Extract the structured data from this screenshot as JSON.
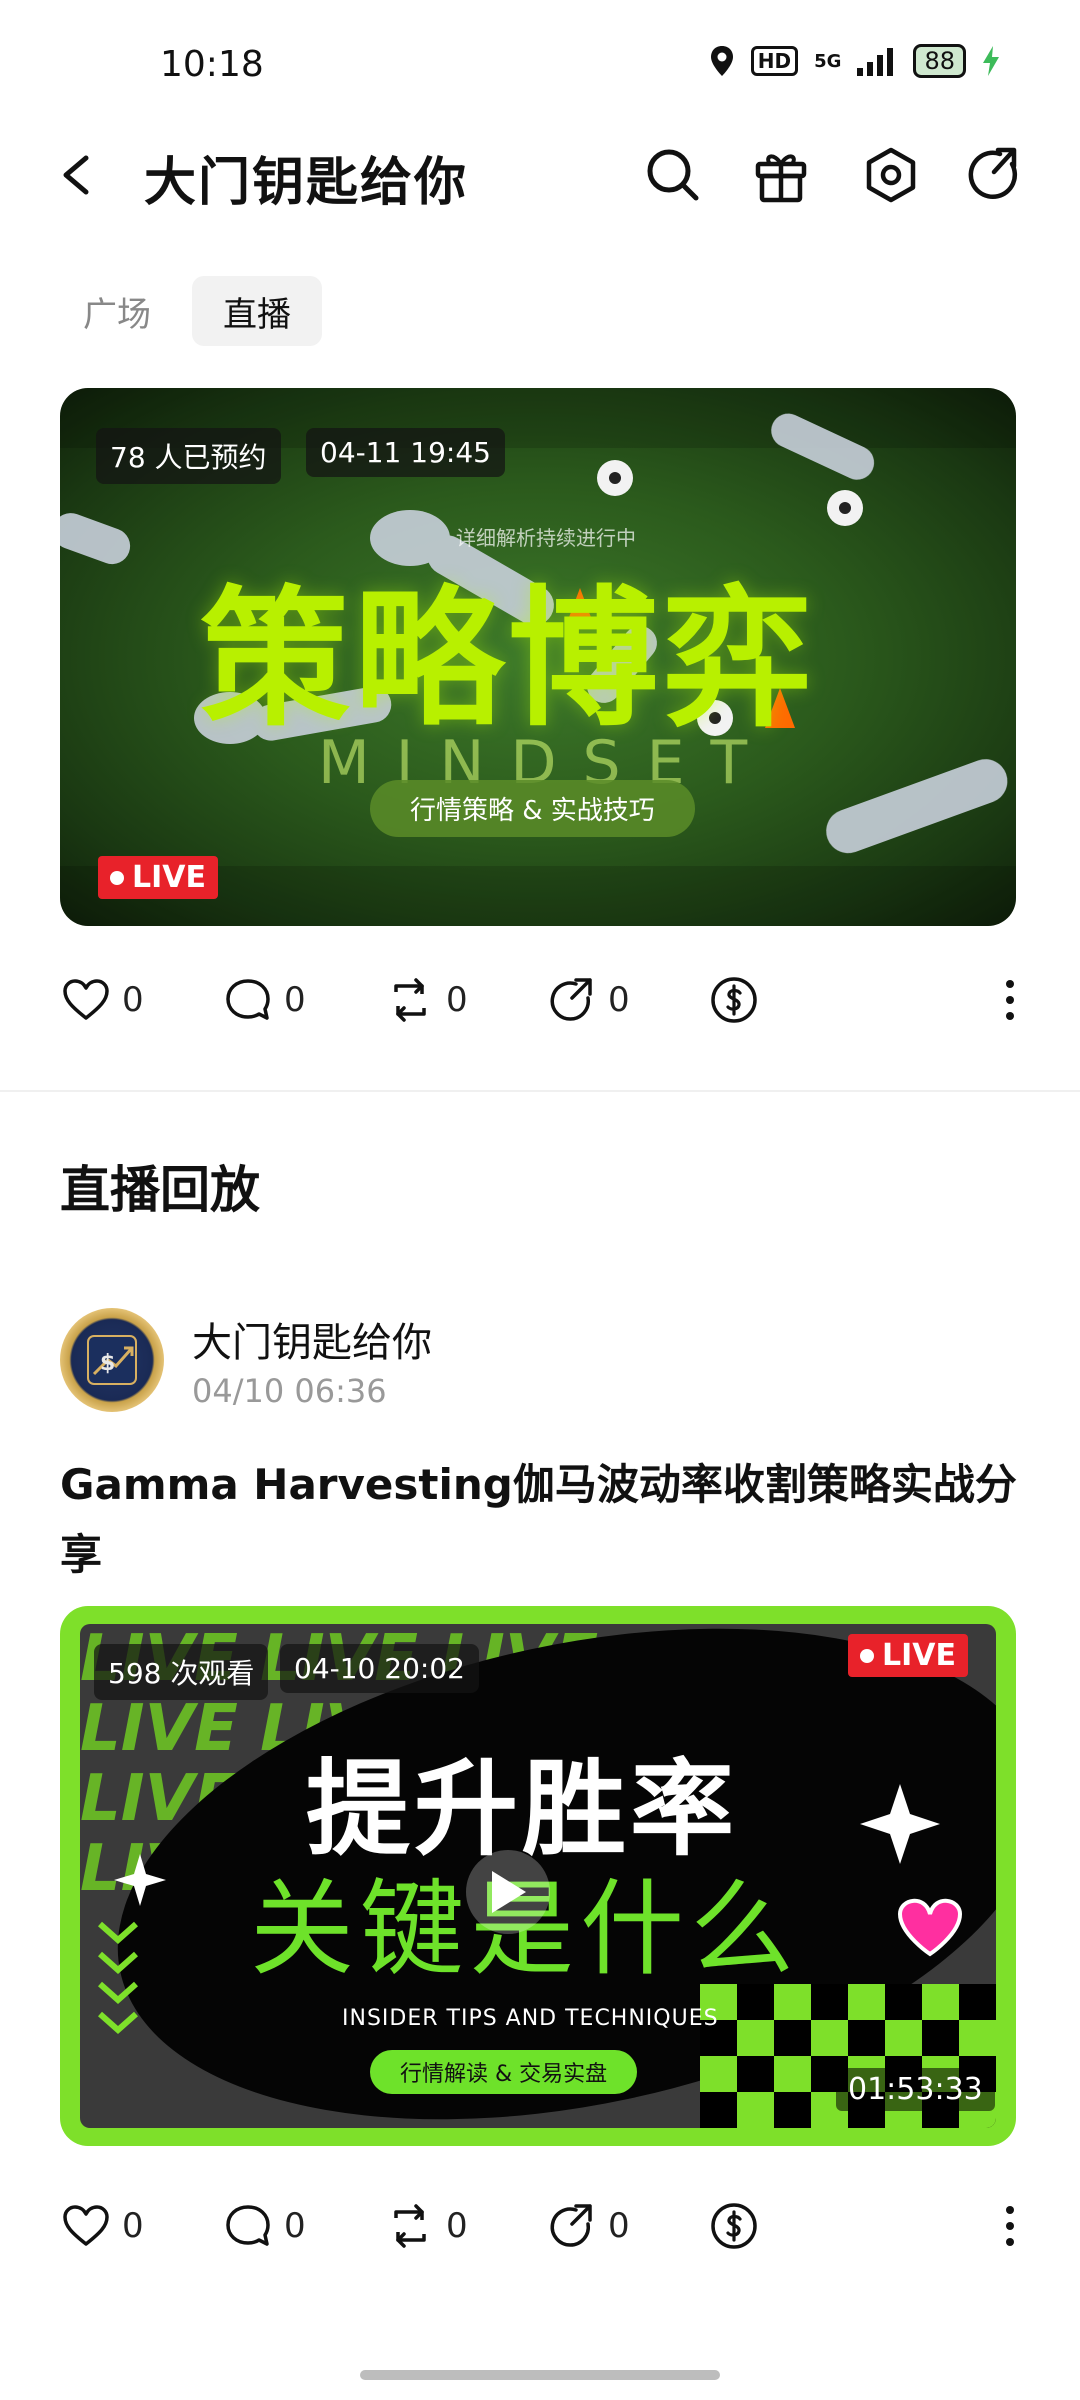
{
  "status_bar": {
    "time": "10:18",
    "hd": "HD",
    "network": "5G",
    "battery": "88"
  },
  "header": {
    "title": "大门钥匙给你",
    "icons": [
      "back-icon",
      "search-icon",
      "gift-icon",
      "settings-icon",
      "share-icon"
    ]
  },
  "tabs": [
    {
      "label": "广场",
      "active": false
    },
    {
      "label": "直播",
      "active": true
    }
  ],
  "live_card": {
    "reservations": "78 人已预约",
    "datetime": "04-11 19:45",
    "small_text": "详细解析持续进行中",
    "headline": "策略博弈",
    "subhead": "MINDSET",
    "caption": "行情策略 & 实战技巧",
    "live_label": "LIVE"
  },
  "actions_1": {
    "like": "0",
    "comment": "0",
    "repost": "0",
    "share": "0"
  },
  "section": {
    "title": "直播回放"
  },
  "post": {
    "author": "大门钥匙给你",
    "time": "04/10 06:36",
    "title": "Gamma Harvesting伽马波动率收割策略实战分享"
  },
  "replay_card": {
    "views": "598 次观看",
    "datetime": "04-10 20:02",
    "live_label": "LIVE",
    "title_line1": "提升胜率",
    "title_line2": "关键是什么",
    "caption": "INSIDER TIPS AND TECHNIQUES",
    "caption_pill": "行情解读 & 交易实盘",
    "duration": "01:53:33",
    "bg_text": "LIVE LIVE LIVE"
  },
  "actions_2": {
    "like": "0",
    "comment": "0",
    "repost": "0",
    "share": "0"
  },
  "colors": {
    "accent_green": "#7ee02a",
    "live_red": "#e8222a",
    "headline_green": "#b8f000"
  }
}
